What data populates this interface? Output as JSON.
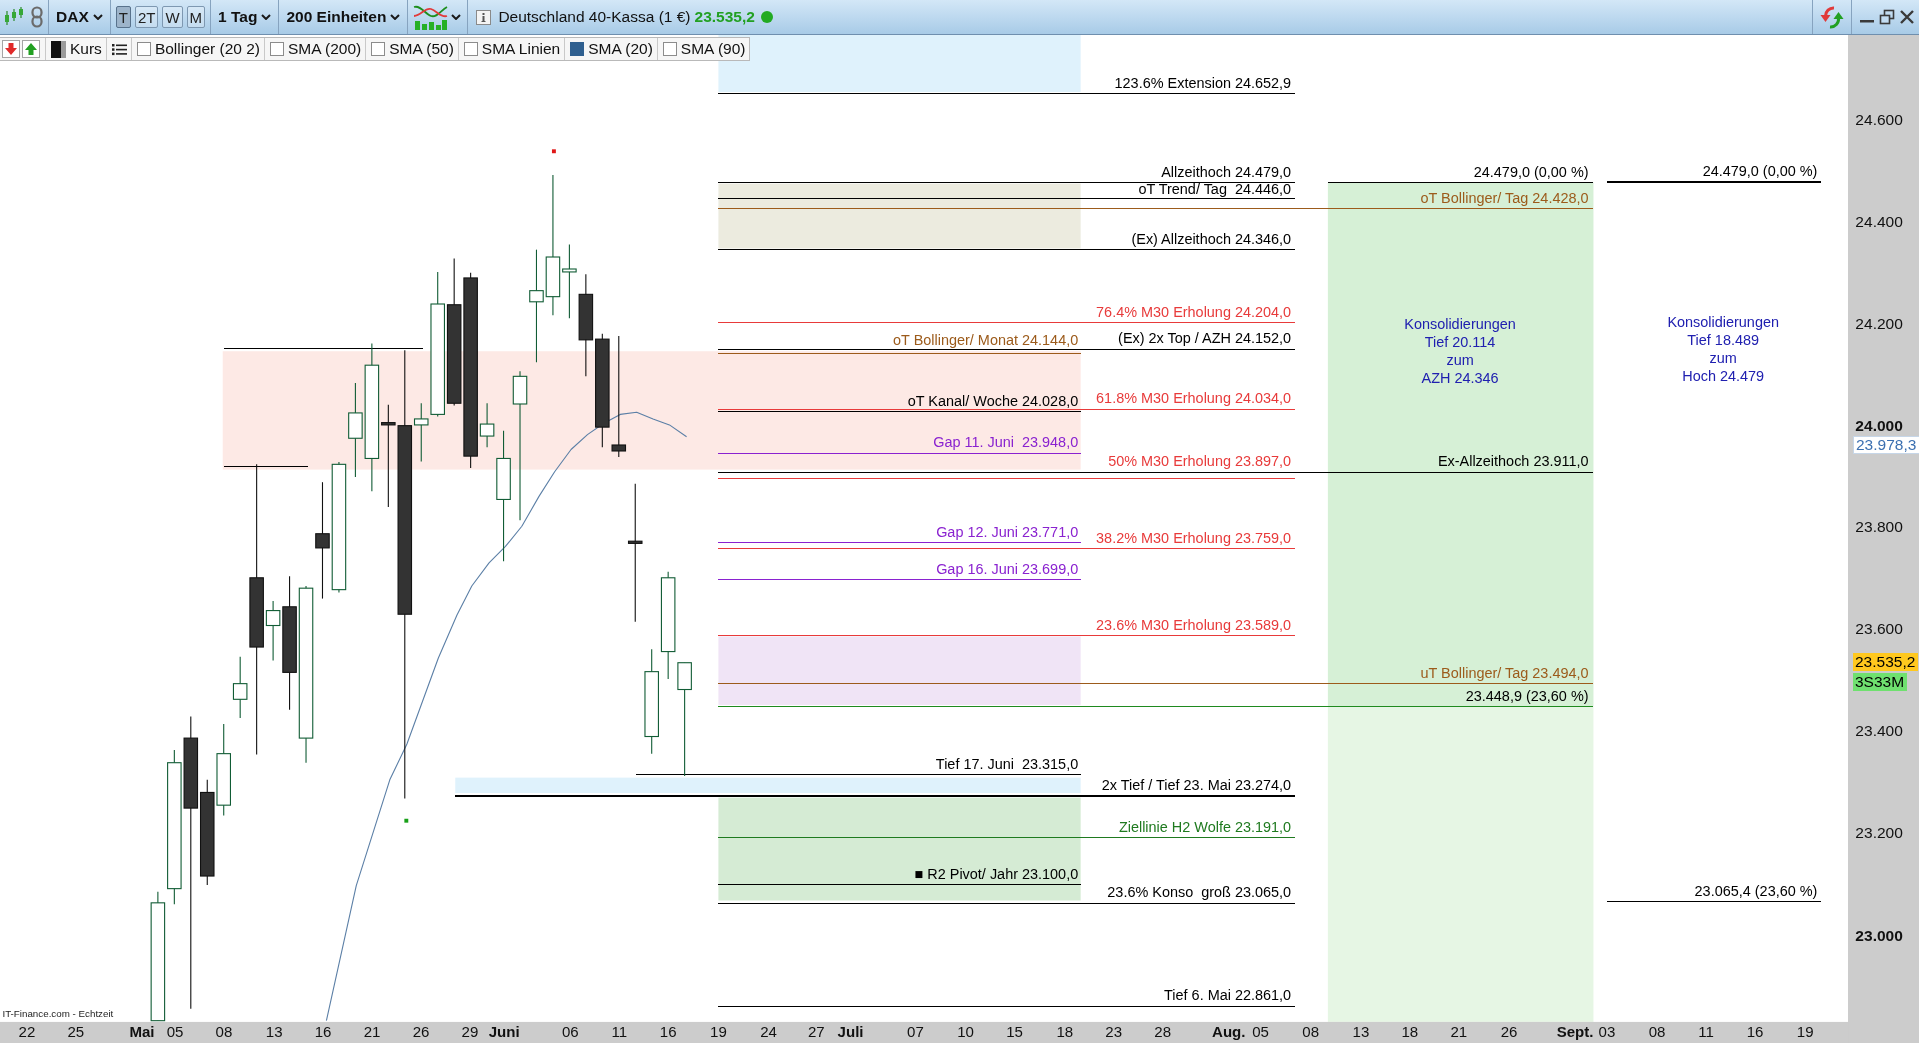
{
  "toolbar": {
    "symbol": "DAX",
    "periods": [
      {
        "label": "T",
        "selected": true
      },
      {
        "label": "2T",
        "selected": false
      },
      {
        "label": "W",
        "selected": false
      },
      {
        "label": "M",
        "selected": false
      }
    ],
    "interval": "1 Tag",
    "units": "200 Einheiten",
    "instrument": "Deutschland 40-Kassa (1 €)",
    "price": "23.535,2",
    "online": true
  },
  "legend": {
    "series": "Kurs",
    "indicators": [
      {
        "label": "Bollinger (20 2)",
        "checked": false
      },
      {
        "label": "SMA (200)",
        "checked": false
      },
      {
        "label": "SMA (50)",
        "checked": false
      },
      {
        "label": "SMA Linien",
        "checked": false
      },
      {
        "label": "SMA (20)",
        "checked": true
      },
      {
        "label": "SMA (90)",
        "checked": false
      }
    ]
  },
  "chart": {
    "levels": [
      {
        "text": "123.6% Extension 24.652,9",
        "color": "#000000",
        "kind": "level"
      },
      {
        "text": "Allzeithoch 24.479,0",
        "color": "#000000",
        "kind": "level"
      },
      {
        "text": "24.479,0 (0,00 %)",
        "color": "#000000",
        "kind": "fib"
      },
      {
        "text": "24.479,0 (0,00 %)",
        "color": "#000000",
        "kind": "fib"
      },
      {
        "text": "oT Trend/ Tag  24.446,0",
        "color": "#000000",
        "kind": "level"
      },
      {
        "text": "oT Bollinger/ Tag 24.428,0",
        "color": "#9c5b1b",
        "kind": "level"
      },
      {
        "text": "(Ex) Allzeithoch 24.346,0",
        "color": "#000000",
        "kind": "level"
      },
      {
        "text": "76.4% M30 Erholung 24.204,0",
        "color": "#e83a3a",
        "kind": "level"
      },
      {
        "text": "oT Bollinger/ Monat 24.144,0",
        "color": "#9c5b1b",
        "kind": "level"
      },
      {
        "text": "(Ex) 2x Top / AZH 24.152,0",
        "color": "#000000",
        "kind": "level"
      },
      {
        "text": "oT Kanal/ Woche 24.028,0",
        "color": "#000000",
        "kind": "level"
      },
      {
        "text": "61.8% M30 Erholung 24.034,0",
        "color": "#e83a3a",
        "kind": "level"
      },
      {
        "text": "Gap 11. Juni  23.948,0",
        "color": "#8a22d0",
        "kind": "level"
      },
      {
        "text": "50% M30 Erholung 23.897,0",
        "color": "#e83a3a",
        "kind": "level"
      },
      {
        "text": "Ex-Allzeithoch 23.911,0",
        "color": "#000000",
        "kind": "level"
      },
      {
        "text": "Gap 12. Juni 23.771,0",
        "color": "#8a22d0",
        "kind": "level"
      },
      {
        "text": "38.2% M30 Erholung 23.759,0",
        "color": "#e83a3a",
        "kind": "level"
      },
      {
        "text": "Gap 16. Juni 23.699,0",
        "color": "#8a22d0",
        "kind": "level"
      },
      {
        "text": "23.6% M30 Erholung 23.589,0",
        "color": "#e83a3a",
        "kind": "level"
      },
      {
        "text": "uT Bollinger/ Tag 23.494,0",
        "color": "#9c5b1b",
        "kind": "level"
      },
      {
        "text": "23.448,9 (23,60 %)",
        "color": "#1f8a1f",
        "kind": "fib"
      },
      {
        "text": "Tief 17. Juni  23.315,0",
        "color": "#000000",
        "kind": "level"
      },
      {
        "text": "2x Tief / Tief 23. Mai 23.274,0",
        "color": "#000000",
        "kind": "level"
      },
      {
        "text": "Ziellinie H2 Wolfe 23.191,0",
        "color": "#1f7a1f",
        "kind": "level"
      },
      {
        "text": "■ R2 Pivot/ Jahr 23.100,0",
        "color": "#000000",
        "kind": "level"
      },
      {
        "text": "23.6% Konso  groß 23.065,0",
        "color": "#000000",
        "kind": "level"
      },
      {
        "text": "23.065,4 (23,60 %)",
        "color": "#000000",
        "kind": "fib"
      },
      {
        "text": "Tief 6. Mai 22.861,0",
        "color": "#000000",
        "kind": "level"
      }
    ],
    "notes": [
      {
        "lines": [
          "Konsolidierungen",
          "Tief 20.114",
          "zum",
          "AZH 24.346"
        ]
      },
      {
        "lines": [
          "Konsolidierungen",
          "Tief 18.489",
          "zum",
          "Hoch 24.479"
        ]
      }
    ],
    "y_axis": [
      {
        "label": "24.600",
        "kind": "minor"
      },
      {
        "label": "24.400",
        "kind": "minor"
      },
      {
        "label": "24.200",
        "kind": "minor"
      },
      {
        "label": "24.000",
        "kind": "major"
      },
      {
        "label": "23.800",
        "kind": "minor"
      },
      {
        "label": "23.600",
        "kind": "minor"
      },
      {
        "label": "23.400",
        "kind": "minor"
      },
      {
        "label": "23.200",
        "kind": "minor"
      },
      {
        "label": "23.000",
        "kind": "major"
      }
    ],
    "price_tags": [
      {
        "text": "23.978,3",
        "kind": "indicator",
        "color": "#ffffff"
      },
      {
        "text": "23.535,2",
        "kind": "quote",
        "color": "#ffc81e"
      },
      {
        "text": "3S33M",
        "kind": "quote",
        "color": "#6fe06f"
      }
    ],
    "x_axis": [
      {
        "label": "22",
        "kind": "day"
      },
      {
        "label": "25",
        "kind": "day"
      },
      {
        "label": "Mai",
        "kind": "month"
      },
      {
        "label": "05",
        "kind": "day"
      },
      {
        "label": "08",
        "kind": "day"
      },
      {
        "label": "13",
        "kind": "day"
      },
      {
        "label": "16",
        "kind": "day"
      },
      {
        "label": "21",
        "kind": "day"
      },
      {
        "label": "26",
        "kind": "day"
      },
      {
        "label": "29",
        "kind": "day"
      },
      {
        "label": "Juni",
        "kind": "month"
      },
      {
        "label": "06",
        "kind": "day"
      },
      {
        "label": "11",
        "kind": "day"
      },
      {
        "label": "16",
        "kind": "day"
      },
      {
        "label": "19",
        "kind": "day"
      },
      {
        "label": "24",
        "kind": "day"
      },
      {
        "label": "27",
        "kind": "day"
      },
      {
        "label": "Juli",
        "kind": "month"
      },
      {
        "label": "07",
        "kind": "day"
      },
      {
        "label": "10",
        "kind": "day"
      },
      {
        "label": "15",
        "kind": "day"
      },
      {
        "label": "18",
        "kind": "day"
      },
      {
        "label": "23",
        "kind": "day"
      },
      {
        "label": "28",
        "kind": "day"
      },
      {
        "label": "Aug.",
        "kind": "month"
      },
      {
        "label": "05",
        "kind": "day"
      },
      {
        "label": "08",
        "kind": "day"
      },
      {
        "label": "13",
        "kind": "day"
      },
      {
        "label": "18",
        "kind": "day"
      },
      {
        "label": "21",
        "kind": "day"
      },
      {
        "label": "26",
        "kind": "day"
      },
      {
        "label": "Sept.",
        "kind": "month"
      },
      {
        "label": "03",
        "kind": "day"
      },
      {
        "label": "08",
        "kind": "day"
      },
      {
        "label": "11",
        "kind": "day"
      },
      {
        "label": "16",
        "kind": "day"
      },
      {
        "label": "19",
        "kind": "day"
      }
    ],
    "source": "IT-Finance.com - Echtzeit"
  }
}
